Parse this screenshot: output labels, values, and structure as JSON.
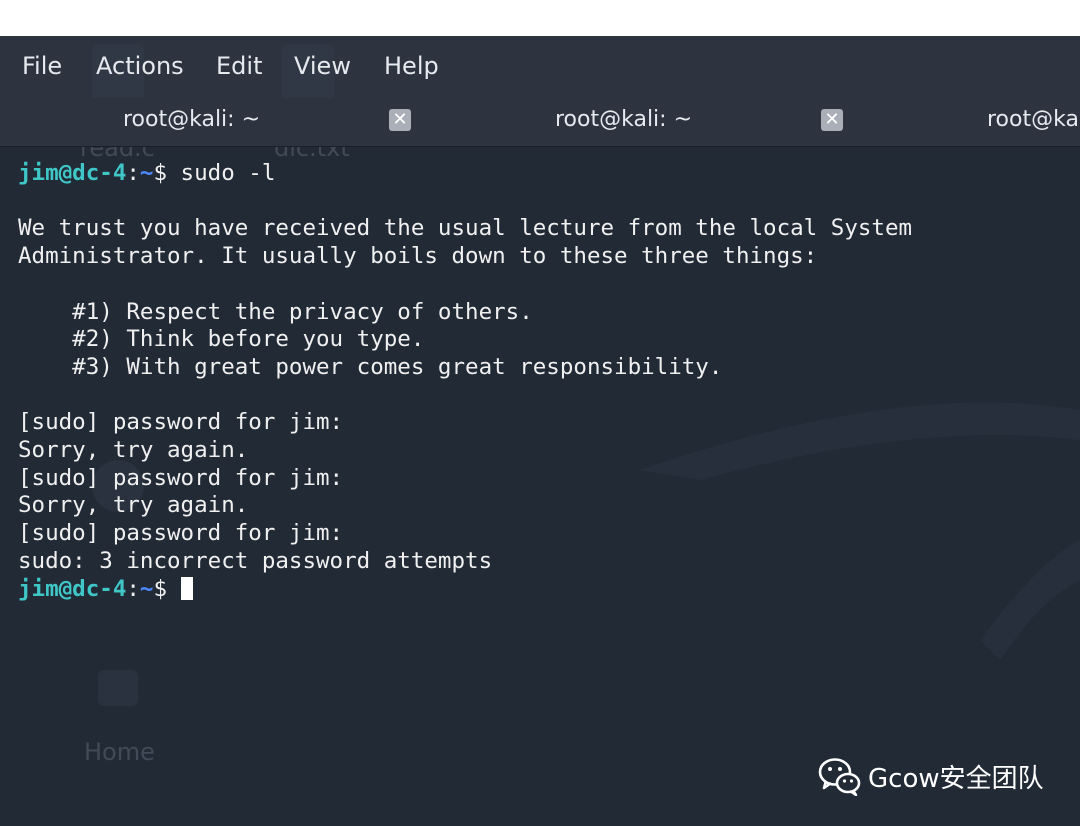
{
  "menu": {
    "items": [
      "File",
      "Actions",
      "Edit",
      "View",
      "Help"
    ]
  },
  "tabs": [
    {
      "label": "root@kali: ~",
      "close_glyph": "✕"
    },
    {
      "label": "root@kali: ~",
      "close_glyph": "✕"
    },
    {
      "label": "root@ka",
      "close_glyph": ""
    }
  ],
  "desktop_ghost": {
    "file1": "read.c",
    "file2": "dic.txt",
    "home": "Home"
  },
  "terminal": {
    "prompt_user": "jim@dc-4",
    "prompt_sep": ":",
    "prompt_path": "~",
    "prompt_symbol": "$",
    "command": " sudo -l",
    "output": [
      "",
      "We trust you have received the usual lecture from the local System",
      "Administrator. It usually boils down to these three things:",
      "",
      "    #1) Respect the privacy of others.",
      "    #2) Think before you type.",
      "    #3) With great power comes great responsibility.",
      "",
      "[sudo] password for jim:",
      "Sorry, try again.",
      "[sudo] password for jim:",
      "Sorry, try again.",
      "[sudo] password for jim:",
      "sudo: 3 incorrect password attempts"
    ]
  },
  "watermark": {
    "icon": "wechat-icon",
    "text": "Gcow安全团队"
  },
  "colors": {
    "background": "#222a36",
    "menubar": "#2d3440",
    "prompt_user": "#3fc6c6",
    "prompt_path": "#4d8cff",
    "text": "#f0f0f0"
  }
}
